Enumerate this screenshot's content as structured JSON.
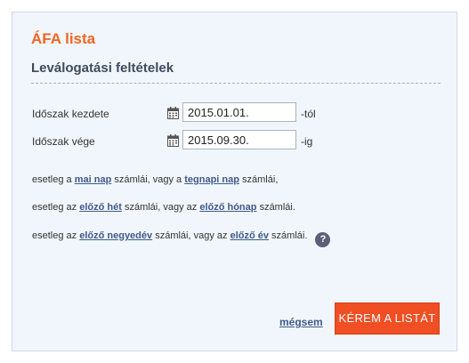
{
  "page": {
    "title": "ÁFA lista",
    "section_title": "Leválogatási feltételek"
  },
  "filters": {
    "start": {
      "label": "Időszak kezdete",
      "value": "2015.01.01.",
      "suffix": "-tól",
      "icon": "calendar-icon"
    },
    "end": {
      "label": "Időszak vége",
      "value": "2015.09.30.",
      "suffix": "-ig",
      "icon": "calendar-icon"
    }
  },
  "quick_links": {
    "line1": {
      "prefix": "esetleg a",
      "link1": "mai nap",
      "middle": "számlái, vagy a",
      "link2": "tegnapi nap",
      "suffix": "számlái,"
    },
    "line2": {
      "prefix": "esetleg az",
      "link1": "előző hét",
      "middle": "számlái, vagy az",
      "link2": "előző hónap",
      "suffix": "számlái."
    },
    "line3": {
      "prefix": "esetleg az",
      "link1": "előző negyedév",
      "middle": "számlái, vagy az",
      "link2": "előző év",
      "suffix": "számlái."
    },
    "help_icon": "?"
  },
  "actions": {
    "cancel_label": "mégsem",
    "submit_label": "KÉREM A LISTÁT"
  },
  "colors": {
    "title": "#f26522",
    "panel_background": "#f1f6fc",
    "link": "#3f5a8a",
    "button": "#f04e23"
  }
}
